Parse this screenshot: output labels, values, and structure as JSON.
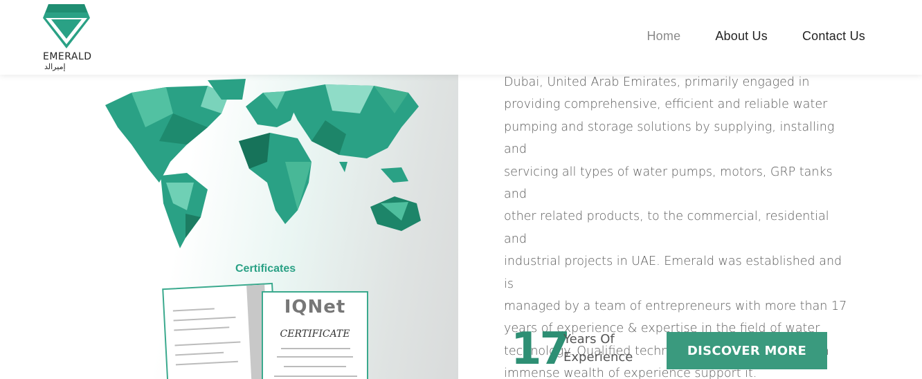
{
  "brand": {
    "name": "EMERALD",
    "arabic_name": "إميرالد",
    "color": "#2aa185"
  },
  "nav": {
    "items": [
      {
        "label": "Home",
        "active": true
      },
      {
        "label": "About Us",
        "active": false
      },
      {
        "label": "Contact Us",
        "active": false
      }
    ]
  },
  "left": {
    "certificates_title": "Certificates",
    "cert_iqnet": "IQNet",
    "cert_word": "CERTIFICATE"
  },
  "about": {
    "lines": [
      "Dubai, United Arab Emirates, primarily engaged in",
      "providing comprehensive, efficient and reliable water",
      "pumping and storage solutions by supplying, installing and",
      "servicing all types of water pumps, motors, GRP tanks and",
      "other related products, to the commercial, residential and",
      "industrial projects in UAE. Emerald was established and is",
      "managed by a team of entrepreneurs with more than 17",
      "years of experience & expertise in the field of water",
      "technology. Qualified technicians & engineers with an",
      "immense wealth of experience support it."
    ]
  },
  "stats": {
    "years": "17",
    "label_line1": "Years Of",
    "label_line2": "Experience"
  },
  "cta": {
    "label": "DISCOVER MORE"
  }
}
